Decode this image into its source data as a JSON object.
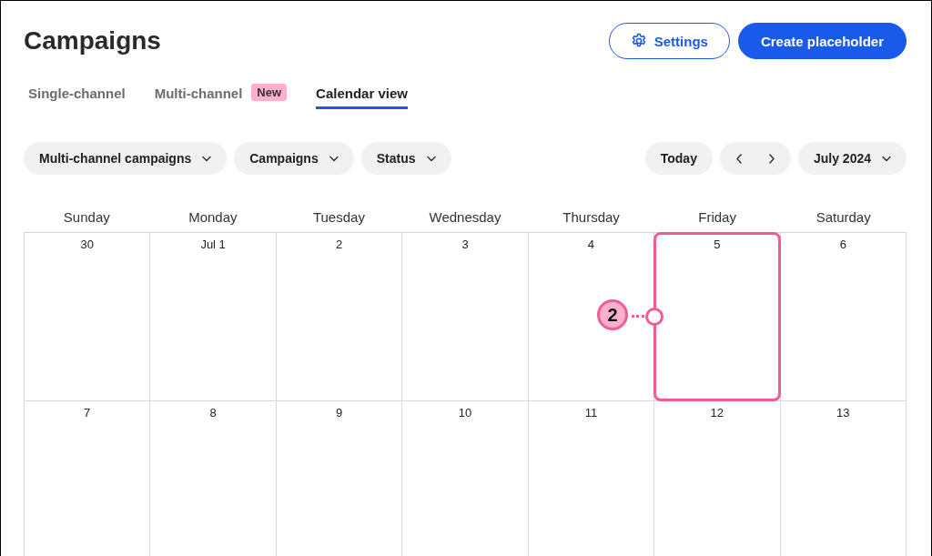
{
  "header": {
    "title": "Campaigns",
    "buttons": [
      {
        "kind": "outline",
        "label": "Settings"
      },
      {
        "kind": "primary",
        "label": "Create placeholder"
      }
    ]
  },
  "tabs": [
    {
      "label": "Single-channel",
      "selected": false
    },
    {
      "label": "Multi-channel",
      "badge": "New",
      "selected": false
    },
    {
      "label": "Calendar view",
      "selected": true
    }
  ],
  "filters": [
    {
      "label": "Multi-channel campaigns"
    },
    {
      "label": "Campaigns"
    },
    {
      "label": "Status"
    }
  ],
  "navigation": {
    "today": "Today",
    "month": "July 2024"
  },
  "calendar": {
    "weekdays": [
      "Sunday",
      "Monday",
      "Tuesday",
      "Wednesday",
      "Thursday",
      "Friday",
      "Saturday"
    ],
    "weeks": [
      {
        "days": [
          {
            "date": "30",
            "highlighted": false
          },
          {
            "date": "Jul 1",
            "highlighted": false
          },
          {
            "date": "2",
            "highlighted": false
          },
          {
            "date": "3",
            "highlighted": false
          },
          {
            "date": "4",
            "highlighted": false
          },
          {
            "date": "5",
            "highlighted": true,
            "callout": "2"
          },
          {
            "date": "6",
            "highlighted": false
          }
        ]
      },
      {
        "days": [
          {
            "date": "7",
            "highlighted": false
          },
          {
            "date": "8",
            "highlighted": false
          },
          {
            "date": "9",
            "highlighted": false
          },
          {
            "date": "10",
            "highlighted": false
          },
          {
            "date": "11",
            "highlighted": false
          },
          {
            "date": "12",
            "highlighted": false
          },
          {
            "date": "13",
            "highlighted": false
          }
        ]
      }
    ]
  }
}
